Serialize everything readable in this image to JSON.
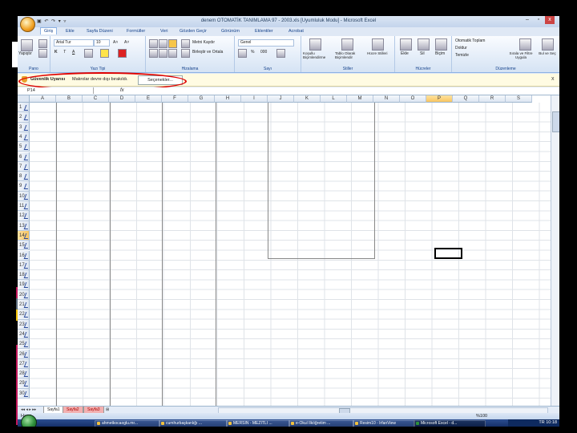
{
  "window": {
    "title": "denem OTOMATİK TANIMLAMA 97 - 2003.xls [Uyumluluk Modu] - Microsoft Excel",
    "quick_access": "▣ ↶ ↷ ▾ ▿",
    "controls": [
      "–",
      "▫",
      "x"
    ]
  },
  "ribbon": {
    "tabs": [
      "Giriş",
      "Ekle",
      "Sayfa Düzeni",
      "Formüller",
      "Veri",
      "Gözden Geçir",
      "Görünüm",
      "Eklentiler",
      "Acrobat"
    ],
    "active_tab": "Giriş",
    "groups": {
      "clipboard": {
        "name": "Pano",
        "paste": "Yapıştır"
      },
      "font": {
        "name": "Yazı Tipi",
        "font_name": "Arial Tur",
        "font_size": "10",
        "bold": "K",
        "italic": "T",
        "underline": "A",
        "grow": "A˄",
        "shrink": "A˅"
      },
      "alignment": {
        "name": "Hizalama",
        "wrap": "Metni Kaydır",
        "merge": "Birleştir ve Ortala"
      },
      "number": {
        "name": "Sayı",
        "format": "Genel",
        "percent": "%",
        "thousands": "000"
      },
      "styles": {
        "name": "Stiller",
        "conditional": "Koşullu Biçimlendirme",
        "table": "Tablo Olarak Biçimlendir",
        "cell": "Hücre Stilleri"
      },
      "cells": {
        "name": "Hücreler",
        "insert": "Ekle",
        "delete": "Sil",
        "format": "Biçim"
      },
      "editing": {
        "name": "Düzenleme",
        "autosum": "Otomatik Toplam",
        "fill": "Doldur",
        "clear": "Temizle",
        "sort": "Sırala ve Filtre Uygula",
        "find": "Bul ve Seç"
      }
    }
  },
  "security_bar": {
    "title": "Güvenlik Uyarısı",
    "message": "Makrolar devre dışı bırakıldı.",
    "button": "Seçenekler...",
    "close": "x"
  },
  "formula_bar": {
    "name_box": "P14",
    "fx": "fx",
    "value": ""
  },
  "sheet": {
    "columns": [
      "A",
      "B",
      "C",
      "D",
      "E",
      "F",
      "G",
      "H",
      "I",
      "J",
      "K",
      "L",
      "M",
      "N",
      "O",
      "P",
      "Q",
      "R",
      "S"
    ],
    "selected_column": "P",
    "rows": [
      "1",
      "2",
      "3",
      "4",
      "5",
      "6",
      "7",
      "8",
      "9",
      "10",
      "11",
      "12",
      "13",
      "14",
      "15",
      "16",
      "17",
      "18",
      "19",
      "20",
      "21",
      "22",
      "23",
      "24",
      "25",
      "26",
      "27",
      "28",
      "29",
      "30"
    ],
    "selected_row": "14",
    "active_cell": "P14"
  },
  "sheet_tabs": {
    "nav": "◂◂ ◂ ▸ ▸▸",
    "tabs": [
      "Sayfa1",
      "Sayfa2",
      "Sayfa3"
    ],
    "new_tab_icon": "⊞"
  },
  "status_bar": {
    "ready": "Hazır",
    "zoom": "%100"
  },
  "taskbar": {
    "items": [
      "ahmetkocaoglu.mr...",
      "cumhurbaşkanlığı ...",
      "MERSİN - MEZİTLİ ...",
      "e-Okul İlköğretim ...",
      "Resim10 - IrfanView",
      "Microsoft Excel - d..."
    ],
    "clock": "10:18",
    "language": "TR"
  }
}
